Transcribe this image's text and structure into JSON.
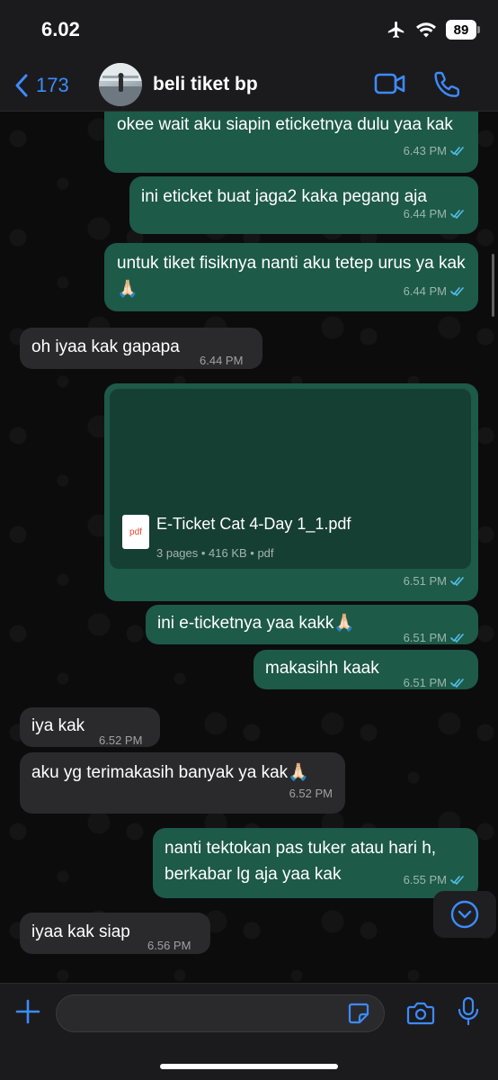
{
  "status_bar": {
    "time": "6.02",
    "battery": "89"
  },
  "header": {
    "back_count": "173",
    "title": "beli tiket bp"
  },
  "colors": {
    "accent": "#3d8bfd",
    "outgoing_bubble": "#1d5a47",
    "incoming_bubble": "#2a2a2c",
    "read_ticks": "#53bdeb"
  },
  "messages": [
    {
      "dir": "out",
      "text": "okee wait aku siapin eticketnya dulu yaa kak",
      "time": "6.43 PM"
    },
    {
      "dir": "out",
      "text": "ini eticket buat jaga2 kaka pegang aja",
      "time": "6.44 PM"
    },
    {
      "dir": "out",
      "text": "untuk tiket fisiknya nanti aku tetep urus ya kak🙏🏻",
      "time": "6.44 PM"
    },
    {
      "dir": "in",
      "text": "oh iyaa kak gapapa",
      "time": "6.44 PM"
    },
    {
      "dir": "out",
      "type": "document",
      "file_name": "E-Ticket Cat 4-Day 1_1.pdf",
      "file_info": "3 pages • 416 KB • pdf",
      "file_type": "pdf",
      "time": "6.51 PM"
    },
    {
      "dir": "out",
      "text": "ini e-ticketnya yaa kakk🙏🏻",
      "time": "6.51 PM"
    },
    {
      "dir": "out",
      "text": "makasihh kaak",
      "time": "6.51 PM"
    },
    {
      "dir": "in",
      "text": "iya kak",
      "time": "6.52 PM"
    },
    {
      "dir": "in",
      "text": "aku yg terimakasih banyak ya kak🙏🏻",
      "time": "6.52 PM"
    },
    {
      "dir": "out",
      "text": "nanti tektokan pas tuker atau hari h, berkabar lg aja yaa kak",
      "time": "6.55 PM"
    },
    {
      "dir": "in",
      "text": "iyaa kak siap",
      "time": "6.56 PM"
    }
  ],
  "input": {
    "value": "",
    "placeholder": ""
  },
  "icons": [
    "airplane-icon",
    "wifi-icon",
    "back-chevron-icon",
    "video-call-icon",
    "phone-icon",
    "double-check-icon",
    "pdf-file-icon",
    "scroll-down-icon",
    "plus-icon",
    "sticker-icon",
    "camera-icon",
    "microphone-icon"
  ]
}
